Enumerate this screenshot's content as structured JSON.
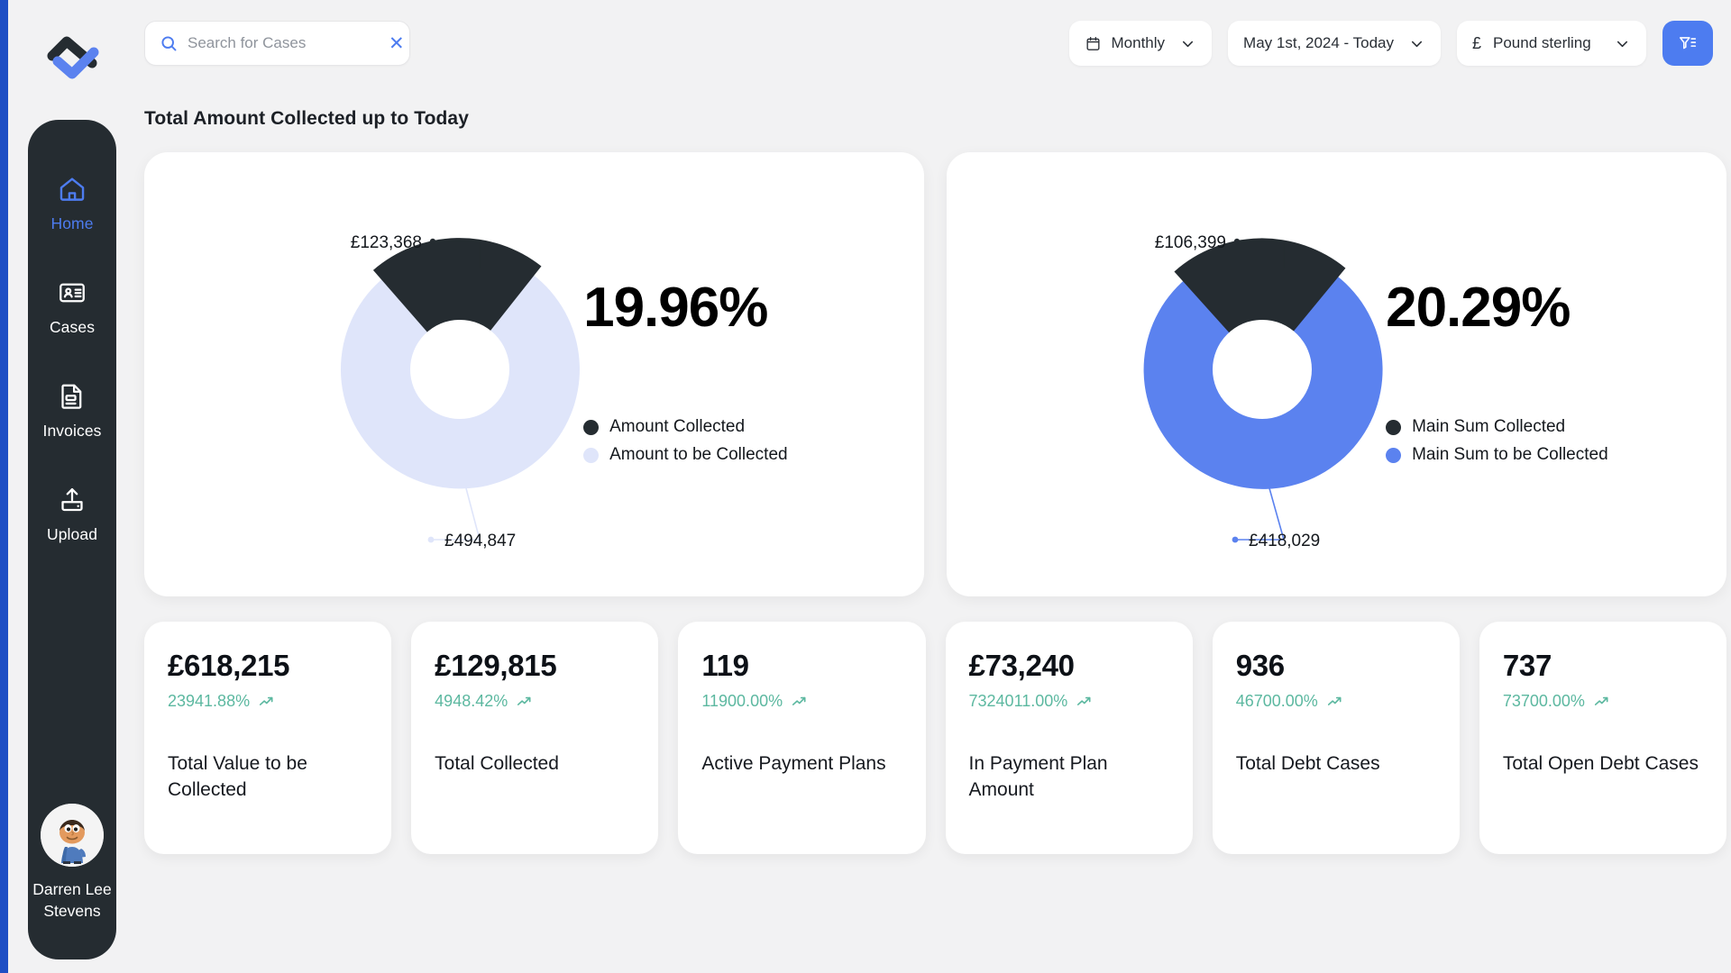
{
  "brand": {
    "logo_icon": "logo-mark",
    "accent_blue": "#4d7cf0",
    "edge_blue": "#1f4fc4",
    "sidebar_dark": "#252c31",
    "positive_green": "#5cb8a0",
    "lavender": "#dfe5fa"
  },
  "search": {
    "placeholder": "Search for Cases",
    "value": "",
    "search_icon": "search-icon",
    "clear_icon": "close-icon"
  },
  "toolbar": {
    "period": {
      "label": "Monthly",
      "icon": "calendar-icon",
      "caret": "chevron-down-icon"
    },
    "date_range": {
      "label": "May 1st, 2024 - Today",
      "caret": "chevron-down-icon"
    },
    "currency": {
      "symbol": "£",
      "label": "Pound sterling",
      "caret": "chevron-down-icon"
    },
    "filter_button": {
      "icon": "filter-icon",
      "label": ""
    }
  },
  "sidebar": {
    "items": [
      {
        "label": "Home",
        "icon": "home-icon",
        "active": true
      },
      {
        "label": "Cases",
        "icon": "id-card-icon",
        "active": false
      },
      {
        "label": "Invoices",
        "icon": "invoice-document-icon",
        "active": false
      },
      {
        "label": "Upload",
        "icon": "upload-icon",
        "active": false
      }
    ],
    "profile": {
      "name": "Darren Lee Stevens",
      "avatar_icon": "avatar"
    }
  },
  "main": {
    "page_title": "Total Amount Collected up to Today"
  },
  "chart_data": [
    {
      "type": "pie",
      "title": "Amount Collected vs Amount to be Collected",
      "center_label": "19.96%",
      "percentage": 19.96,
      "currency_symbol": "£",
      "labels": [
        "Amount Collected",
        "Amount to be Collected"
      ],
      "values": [
        123368,
        494847
      ],
      "value_labels": [
        "£123,368",
        "£494,847"
      ],
      "colors": [
        "#252c31",
        "#dfe5fa"
      ],
      "legend": [
        "Amount Collected",
        "Amount to be Collected"
      ],
      "legend_position": "right",
      "donut": true
    },
    {
      "type": "pie",
      "title": "Main Sum Collected vs Main Sum to be Collected",
      "center_label": "20.29%",
      "percentage": 20.29,
      "currency_symbol": "£",
      "labels": [
        "Main Sum Collected",
        "Main Sum to be Collected"
      ],
      "values": [
        106399,
        418029
      ],
      "value_labels": [
        "£106,399",
        "£418,029"
      ],
      "colors": [
        "#252c31",
        "#5b82ef"
      ],
      "legend": [
        "Main Sum Collected",
        "Main Sum to be Collected"
      ],
      "legend_position": "right",
      "donut": true
    }
  ],
  "kpis": [
    {
      "value": "£618,215",
      "delta": "23941.88%",
      "trend": "up",
      "label": "Total Value to be Collected"
    },
    {
      "value": "£129,815",
      "delta": "4948.42%",
      "trend": "up",
      "label": "Total Collected"
    },
    {
      "value": "119",
      "delta": "11900.00%",
      "trend": "up",
      "label": "Active Payment Plans"
    },
    {
      "value": "£73,240",
      "delta": "7324011.00%",
      "trend": "up",
      "label": "In Payment Plan Amount"
    },
    {
      "value": "936",
      "delta": "46700.00%",
      "trend": "up",
      "label": "Total Debt Cases"
    },
    {
      "value": "737",
      "delta": "73700.00%",
      "trend": "up",
      "label": "Total Open Debt Cases"
    }
  ]
}
